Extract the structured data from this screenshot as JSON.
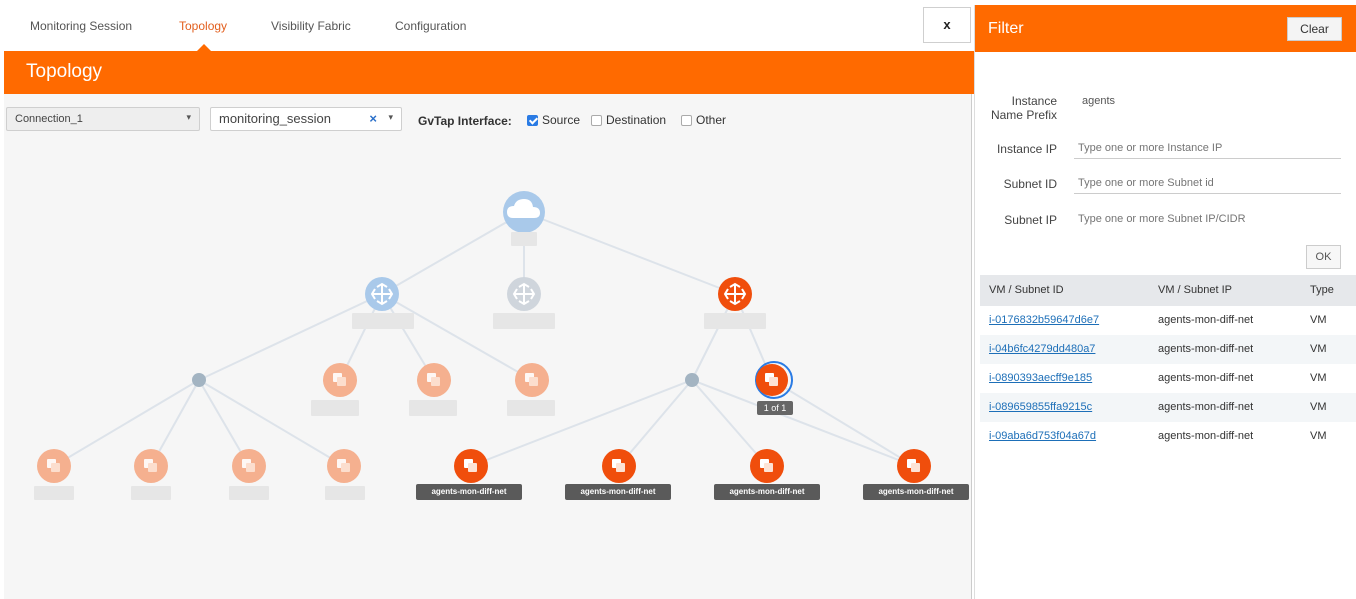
{
  "tabs": [
    {
      "label": "Monitoring Session"
    },
    {
      "label": "Topology"
    },
    {
      "label": "Visibility Fabric"
    },
    {
      "label": "Configuration"
    }
  ],
  "page_title": "Topology",
  "controls": {
    "connection_select": "Connection_1",
    "session_select": "monitoring_session",
    "clear_symbol": "×",
    "caret": "▾",
    "gvtap_label": "GvTap Interface:",
    "checkbox_source": "Source",
    "checkbox_destination": "Destination",
    "checkbox_other": "Other"
  },
  "topology": {
    "badge": "1 of 1",
    "vm_labels": [
      "agents-mon-diff-net",
      "agents-mon-diff-net",
      "agents-mon-diff-net",
      "agents-mon-diff-net"
    ]
  },
  "close_button": "x",
  "filter": {
    "title": "Filter",
    "clear_label": "Clear",
    "instance_prefix_label_1": "Instance",
    "instance_prefix_label_2": "Name Prefix",
    "instance_prefix_value": "agents",
    "instance_ip_label": "Instance IP",
    "instance_ip_placeholder": "Type one or more Instance IP",
    "subnet_id_label": "Subnet ID",
    "subnet_id_placeholder": "Type one or more Subnet id",
    "subnet_ip_label": "Subnet IP",
    "subnet_ip_placeholder": "Type one or more Subnet IP/CIDR",
    "ok_label": "OK",
    "columns": [
      "VM / Subnet ID",
      "VM / Subnet IP",
      "Type"
    ],
    "rows": [
      {
        "id": "i-0176832b59647d6e7",
        "ip": "agents-mon-diff-net",
        "type": "VM"
      },
      {
        "id": "i-04b6fc4279dd480a7",
        "ip": "agents-mon-diff-net",
        "type": "VM"
      },
      {
        "id": "i-0890393aecff9e185",
        "ip": "agents-mon-diff-net",
        "type": "VM"
      },
      {
        "id": "i-089659855ffa9215c",
        "ip": "agents-mon-diff-net",
        "type": "VM"
      },
      {
        "id": "i-09aba6d753f04a67d",
        "ip": "agents-mon-diff-net",
        "type": "VM"
      }
    ]
  },
  "colors": {
    "accent": "#ff6a00",
    "faded_vm": "#f5b08f",
    "router_blue": "#a9c9ea",
    "router_gray": "#cfd5dc",
    "link": "#1d6fb8"
  }
}
